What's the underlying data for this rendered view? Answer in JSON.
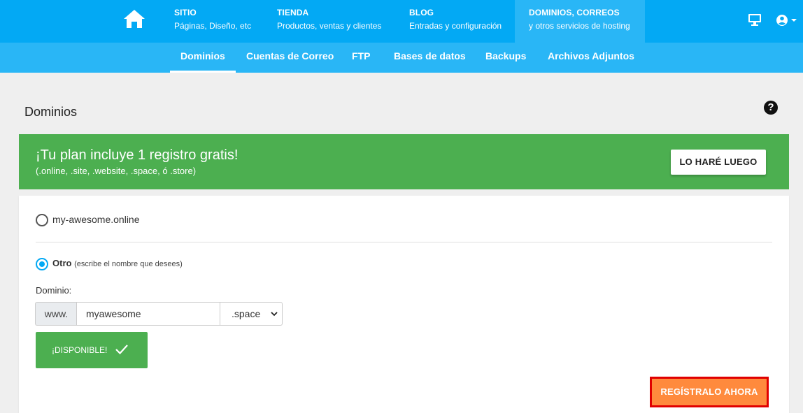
{
  "topnav": {
    "items": [
      {
        "title": "SITIO",
        "subtitle": "Páginas, Diseño, etc"
      },
      {
        "title": "TIENDA",
        "subtitle": "Productos, ventas y clientes"
      },
      {
        "title": "BLOG",
        "subtitle": "Entradas y configuración"
      },
      {
        "title": "DOMINIOS, CORREOS",
        "subtitle": "y otros servicios de hosting"
      }
    ],
    "active_index": 3,
    "icons": {
      "home": "home-icon",
      "monitor": "monitor-icon",
      "user": "user-icon"
    }
  },
  "subnav": {
    "items": [
      {
        "label": "Dominios"
      },
      {
        "label": "Cuentas de Correo"
      },
      {
        "label": "FTP"
      },
      {
        "label": "Bases de datos"
      },
      {
        "label": "Backups"
      },
      {
        "label": "Archivos Adjuntos"
      }
    ],
    "active_index": 0
  },
  "page": {
    "title": "Dominios",
    "help_symbol": "?"
  },
  "banner": {
    "headline": "¡Tu plan incluye 1 registro gratis!",
    "subtext": "(.online, .site, .website, .space, ó .store)",
    "later_button": "LO HARÉ LUEGO",
    "color": "#4caf50"
  },
  "form": {
    "option1_label": "my-awesome.online",
    "option1_checked": false,
    "option2_label": "Otro",
    "option2_hint": "(escribe el nombre que desees)",
    "option2_checked": true,
    "domain_label": "Dominio:",
    "prefix": "www.",
    "domain_value": "myawesome",
    "tld_selected": ".space",
    "available_label": "¡DISPONIBLE!",
    "register_button": "REGÍSTRALO AHORA"
  },
  "colors": {
    "primary": "#03a9f4",
    "secondary": "#29b6f6",
    "success": "#4caf50",
    "cta": "#ff8a3d",
    "cta_border": "#e00000"
  }
}
